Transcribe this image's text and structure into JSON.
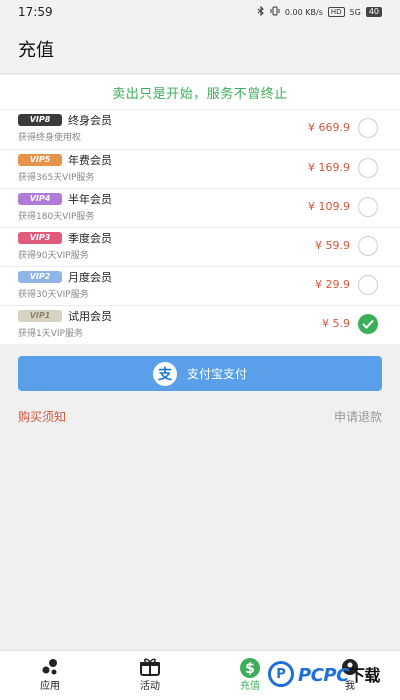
{
  "status_bar": {
    "time": "17:59",
    "net_speed": "0.00 KB/s",
    "hd": "HD",
    "signal": "5G",
    "battery": "40"
  },
  "header": {
    "title": "充值"
  },
  "slogan": "卖出只是开始，服务不曾终止",
  "plans": [
    {
      "badge": "VIP8",
      "name": "终身会员",
      "desc": "获得终身使用权",
      "price": "¥ 669.9",
      "selected": false,
      "badge_color": "#3a3a3a"
    },
    {
      "badge": "VIP5",
      "name": "年费会员",
      "desc": "获得365天VIP服务",
      "price": "¥ 169.9",
      "selected": false,
      "badge_color": "#e8934a"
    },
    {
      "badge": "VIP4",
      "name": "半年会员",
      "desc": "获得180天VIP服务",
      "price": "¥ 109.9",
      "selected": false,
      "badge_color": "#b07ad6"
    },
    {
      "badge": "VIP3",
      "name": "季度会员",
      "desc": "获得90天VIP服务",
      "price": "¥ 59.9",
      "selected": false,
      "badge_color": "#e05a7a"
    },
    {
      "badge": "VIP2",
      "name": "月度会员",
      "desc": "获得30天VIP服务",
      "price": "¥ 29.9",
      "selected": false,
      "badge_color": "#8fb4e6"
    },
    {
      "badge": "VIP1",
      "name": "试用会员",
      "desc": "获得1天VIP服务",
      "price": "¥ 5.9",
      "selected": true,
      "badge_color": "#d8d2c2"
    }
  ],
  "pay_button": {
    "label": "支付宝支付",
    "icon_char": "支"
  },
  "links": {
    "purchase_notice": "购买须知",
    "refund": "申请退款"
  },
  "nav": [
    {
      "label": "应用",
      "icon": "apps-icon",
      "active": false
    },
    {
      "label": "活动",
      "icon": "gift-icon",
      "active": false
    },
    {
      "label": "充值",
      "icon": "dollar-icon",
      "active": true
    },
    {
      "label": "我",
      "icon": "profile-icon",
      "active": false
    }
  ],
  "watermark": {
    "brand": "PCPC",
    "suffix": "下载"
  },
  "colors": {
    "accent_green": "#3cae5a",
    "price_red": "#d9533a",
    "pay_blue": "#5a9fea"
  }
}
